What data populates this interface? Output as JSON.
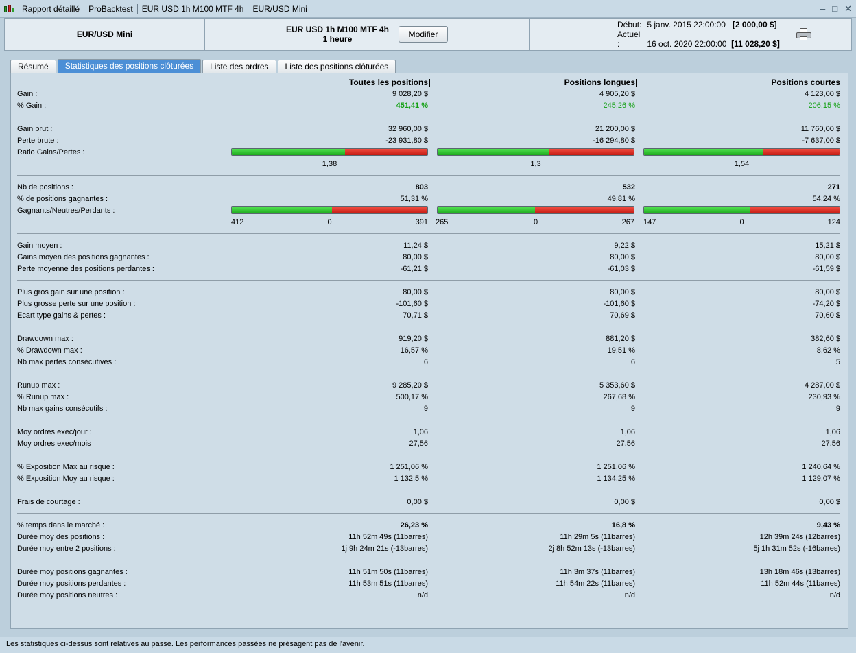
{
  "titlebar": {
    "segments": [
      "Rapport détaillé",
      "ProBacktest",
      "EUR USD 1h M100 MTF 4h",
      "EUR/USD Mini"
    ],
    "controls": [
      "–",
      "□",
      "✕"
    ]
  },
  "header": {
    "instrument": "EUR/USD Mini",
    "strategy_name": "EUR USD 1h M100 MTF 4h",
    "timeframe": "1 heure",
    "modify_label": "Modifier",
    "start_caption": "Début:",
    "start_date": "5 janv. 2015 22:00:00",
    "start_capital": "[2 000,00 $]",
    "end_caption": "Actuel :",
    "end_date": "16 oct. 2020 22:00:00",
    "end_capital": "[11 028,20 $]"
  },
  "tabs": [
    "Résumé",
    "Statistiques des positions clôturées",
    "Liste des ordres",
    "Liste des positions clôturées"
  ],
  "columns": [
    "Toutes les positions",
    "Positions longues",
    "Positions courtes"
  ],
  "sections": {
    "gain": [
      {
        "label": "Gain :",
        "values": [
          "9 028,20 $",
          "4 905,20 $",
          "4 123,00 $"
        ]
      },
      {
        "label": "% Gain :",
        "values": [
          "451,41 %",
          "245,26 %",
          "206,15 %"
        ]
      }
    ],
    "gross": [
      {
        "label": "Gain brut :",
        "values": [
          "32 960,00 $",
          "21 200,00 $",
          "11 760,00 $"
        ]
      },
      {
        "label": "Perte brute :",
        "values": [
          "-23 931,80 $",
          "-16 294,80 $",
          "-7 637,00 $"
        ]
      }
    ],
    "ratio": {
      "label": "Ratio Gains/Pertes :",
      "values": [
        "1,38",
        "1,3",
        "1,54"
      ],
      "green_fraction": [
        0.58,
        0.565,
        0.606
      ]
    },
    "positions": [
      {
        "label": "Nb de positions :",
        "values": [
          "803",
          "532",
          "271"
        ]
      },
      {
        "label": "% de positions gagnantes :",
        "values": [
          "51,31 %",
          "49,81 %",
          "54,24 %"
        ]
      }
    ],
    "wnl": {
      "label": "Gagnants/Neutres/Perdants :",
      "cols": [
        {
          "w": "412",
          "n": "0",
          "l": "391",
          "green_fraction": 0.513
        },
        {
          "w": "265",
          "n": "0",
          "l": "267",
          "green_fraction": 0.498
        },
        {
          "w": "147",
          "n": "0",
          "l": "124",
          "green_fraction": 0.542
        }
      ]
    },
    "average": [
      {
        "label": "Gain moyen :",
        "values": [
          "11,24 $",
          "9,22 $",
          "15,21 $"
        ]
      },
      {
        "label": "Gains moyen des positions gagnantes :",
        "values": [
          "80,00 $",
          "80,00 $",
          "80,00 $"
        ]
      },
      {
        "label": "Perte moyenne des positions perdantes :",
        "values": [
          "-61,21 $",
          "-61,03 $",
          "-61,59 $"
        ]
      }
    ],
    "extremes": [
      {
        "label": "Plus gros gain sur une position :",
        "values": [
          "80,00 $",
          "80,00 $",
          "80,00 $"
        ]
      },
      {
        "label": "Plus grosse perte sur une position :",
        "values": [
          "-101,60 $",
          "-101,60 $",
          "-74,20 $"
        ]
      },
      {
        "label": "Ecart type gains & pertes :",
        "values": [
          "70,71 $",
          "70,69 $",
          "70,60 $"
        ]
      }
    ],
    "drawdown": [
      {
        "label": "Drawdown max :",
        "values": [
          "919,20 $",
          "881,20 $",
          "382,60 $"
        ]
      },
      {
        "label": "% Drawdown max :",
        "values": [
          "16,57 %",
          "19,51 %",
          "8,62 %"
        ]
      },
      {
        "label": "Nb max pertes consécutives :",
        "values": [
          "6",
          "6",
          "5"
        ]
      }
    ],
    "runup": [
      {
        "label": "Runup max :",
        "values": [
          "9 285,20 $",
          "5 353,60 $",
          "4 287,00 $"
        ]
      },
      {
        "label": "% Runup max :",
        "values": [
          "500,17 %",
          "267,68 %",
          "230,93 %"
        ]
      },
      {
        "label": "Nb max gains consécutifs :",
        "values": [
          "9",
          "9",
          "9"
        ]
      }
    ],
    "orders": [
      {
        "label": "Moy ordres exec/jour :",
        "values": [
          "1,06",
          "1,06",
          "1,06"
        ]
      },
      {
        "label": "Moy ordres exec/mois",
        "values": [
          "27,56",
          "27,56",
          "27,56"
        ]
      }
    ],
    "exposure": [
      {
        "label": "% Exposition Max au risque :",
        "values": [
          "1 251,06 %",
          "1 251,06 %",
          "1 240,64 %"
        ]
      },
      {
        "label": "% Exposition Moy au risque :",
        "values": [
          "1 132,5 %",
          "1 134,25 %",
          "1 129,07 %"
        ]
      }
    ],
    "fees": [
      {
        "label": "Frais de courtage :",
        "values": [
          "0,00 $",
          "0,00 $",
          "0,00 $"
        ]
      }
    ],
    "time": [
      {
        "label": "% temps dans le marché :",
        "values": [
          "26,23 %",
          "16,8 %",
          "9,43 %"
        ]
      },
      {
        "label": "Durée moy des positions :",
        "values": [
          "11h 52m 49s (11barres)",
          "11h 29m 5s (11barres)",
          "12h 39m 24s (12barres)"
        ]
      },
      {
        "label": "Durée moy entre 2 positions :",
        "values": [
          "1j 9h 24m 21s (-13barres)",
          "2j 8h 52m 13s (-13barres)",
          "5j 1h 31m 52s (-16barres)"
        ]
      }
    ],
    "durations": [
      {
        "label": "Durée moy positions gagnantes :",
        "values": [
          "11h 51m 50s (11barres)",
          "11h 3m 37s (11barres)",
          "13h 18m 46s (13barres)"
        ]
      },
      {
        "label": "Durée moy positions perdantes :",
        "values": [
          "11h 53m 51s (11barres)",
          "11h 54m 22s (11barres)",
          "11h 52m 44s (11barres)"
        ]
      },
      {
        "label": "Durée moy positions neutres :",
        "values": [
          "n/d",
          "n/d",
          "n/d"
        ]
      }
    ]
  },
  "status_bar": "Les statistiques ci-dessus sont relatives au passé. Les performances passées ne présagent pas de l'avenir.",
  "colors": {
    "bar_green": "#2fc82f",
    "bar_red": "#d9261c",
    "positive_text": "#13a013",
    "active_tab": "#4c8fd6"
  }
}
